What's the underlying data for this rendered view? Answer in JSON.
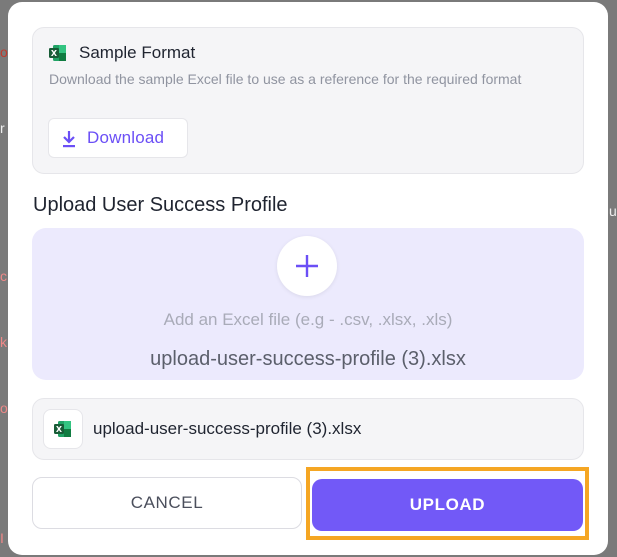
{
  "background": {
    "fragments": [
      "or",
      "r",
      "u",
      "c",
      "k",
      "or",
      "I"
    ]
  },
  "sample_format": {
    "title": "Sample Format",
    "description": "Download the sample Excel file to use as a reference for the required format",
    "icon": "excel-icon",
    "download_label": "Download",
    "download_icon": "download-icon"
  },
  "upload_section": {
    "title": "Upload User Success Profile",
    "add_icon": "plus-icon",
    "hint": "Add an Excel file (e.g - .csv, .xlsx, .xls)",
    "selected_filename": "upload-user-success-profile (3).xlsx"
  },
  "file_row": {
    "icon": "excel-icon",
    "filename": "upload-user-success-profile (3).xlsx"
  },
  "actions": {
    "cancel_label": "CANCEL",
    "upload_label": "UPLOAD"
  },
  "colors": {
    "accent": "#7259f7",
    "highlight": "#f5a623",
    "excel_green": "#1f8a4c"
  }
}
